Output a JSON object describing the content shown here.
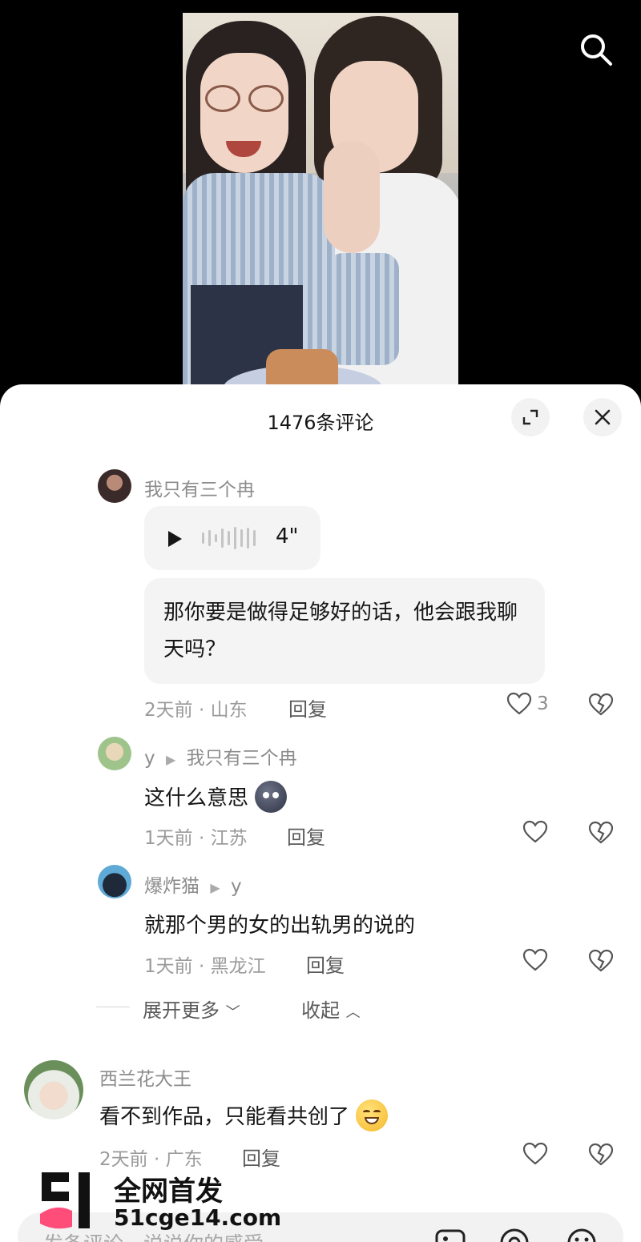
{
  "header": {
    "comment_count_title": "1476条评论"
  },
  "comments": [
    {
      "username": "我只有三个冉",
      "voice_duration": "4\"",
      "text": "那你要是做得足够好的话，他会跟我聊天吗？",
      "time_location": "2天前 · 山东",
      "reply_label": "回复",
      "like_count": "3"
    },
    {
      "username": "y",
      "reply_to": "我只有三个冉",
      "text": "这什么意思",
      "time_location": "1天前 · 江苏",
      "reply_label": "回复"
    },
    {
      "username": "爆炸猫",
      "reply_to": "y",
      "text": "就那个男的女的出轨男的说的",
      "time_location": "1天前 · 黑龙江",
      "reply_label": "回复"
    },
    {
      "username": "西兰花大王",
      "text": "看不到作品，只能看共创了",
      "time_location": "2天前 · 广东",
      "reply_label": "回复"
    }
  ],
  "thread_controls": {
    "expand_more": "展开更多",
    "collapse": "收起"
  },
  "input": {
    "placeholder": "发条评论，说说你的感受"
  },
  "watermark": {
    "title": "全网首发",
    "url": "51cge14.com"
  },
  "colors": {
    "sheet_bg": "#ffffff",
    "bubble_bg": "#f4f4f4",
    "meta_text": "#9b9b9b",
    "primary_text": "#161616"
  }
}
